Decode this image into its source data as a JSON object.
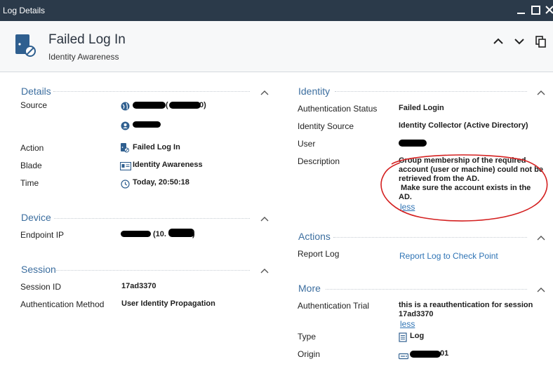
{
  "window": {
    "title": "Log Details"
  },
  "header": {
    "title": "Failed Log In",
    "subtitle": "Identity Awareness"
  },
  "details": {
    "title": "Details",
    "source_label": "Source",
    "source_ip_fragment": "(",
    "source_ip_close": "0)",
    "action_label": "Action",
    "action_value": "Failed Log In",
    "blade_label": "Blade",
    "blade_value": "Identity Awareness",
    "time_label": "Time",
    "time_value": "Today, 20:50:18"
  },
  "device": {
    "title": "Device",
    "endpoint_label": "Endpoint IP",
    "endpoint_open": "(10.",
    "endpoint_close": ")"
  },
  "session": {
    "title": "Session",
    "id_label": "Session ID",
    "id_value": "17ad3370",
    "method_label": "Authentication Method",
    "method_value": "User Identity Propagation"
  },
  "identity": {
    "title": "Identity",
    "auth_status_label": "Authentication Status",
    "auth_status_value": "Failed Login",
    "source_label": "Identity Source",
    "source_value": "Identity Collector (Active Directory)",
    "user_label": "User",
    "description_label": "Description",
    "description_lines": [
      "Group membership of the required",
      "account (user or machine) could not be",
      "retrieved from the AD.",
      " Make sure the account exists in the",
      "AD."
    ],
    "less_link": "less"
  },
  "actions": {
    "title": "Actions",
    "report_label": "Report Log",
    "report_link": "Report Log to Check Point"
  },
  "more": {
    "title": "More",
    "trial_label": "Authentication Trial",
    "trial_lines": [
      "this is a reauthentication for session",
      "17ad3370"
    ],
    "less_link": "less",
    "type_label": "Type",
    "type_value": "Log",
    "origin_label": "Origin",
    "origin_suffix": "01"
  },
  "icons": {
    "minimize": "minimize-icon",
    "maximize": "maximize-icon",
    "close": "close-icon",
    "up": "chevron-up-icon",
    "down": "chevron-down-icon",
    "copy": "copy-icon"
  },
  "colors": {
    "titlebar": "#2b3a4a",
    "section_title": "#3c6e9f",
    "link": "#2f74b5",
    "annotation": "#d42020"
  }
}
